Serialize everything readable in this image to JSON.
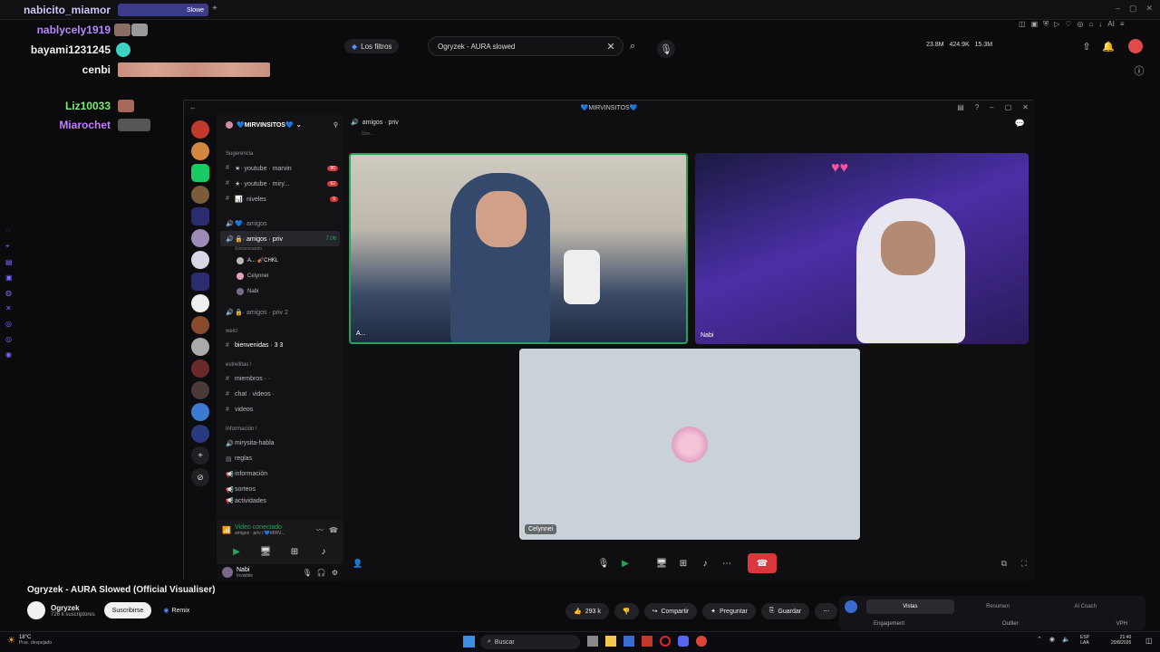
{
  "colors": {
    "accent_green": "#23a55a",
    "danger_red": "#da373c",
    "purple": "#b58cff",
    "yt_red": "#ff0000"
  },
  "browser": {
    "tab_title": "Slowe",
    "tab_new": "+"
  },
  "youtube_top": {
    "filters_label": "Los filtros",
    "search_value": "Ogryzek - AURA slowed",
    "stats": [
      "23.8M",
      "424.9K",
      "15.3M"
    ]
  },
  "chat_overlay": [
    {
      "name": "nabicito_miamor",
      "color": "#d3c6ff"
    },
    {
      "name": "nablycely1919",
      "color": "#b58cff"
    },
    {
      "name": "bayami1231245",
      "color": "#f1f1f1"
    },
    {
      "name": "cenbi",
      "color": "#f1f1f1"
    },
    {
      "name": "Liz10033",
      "color": "#7cf06b"
    },
    {
      "name": "Miarochet",
      "color": "#c77dff"
    }
  ],
  "discord": {
    "window_title": "💙MIRVINSITOS💙",
    "server_name": "💙MIRVINSITOS💙",
    "header_channel": "amigos · priv",
    "header_sub": "Stre...",
    "categories": [
      {
        "label": "Sugerencia",
        "channels": [
          {
            "label": "★· youtube · marvin",
            "badge": "80",
            "icon": "#"
          },
          {
            "label": "★· youtube · miry...",
            "badge": "62",
            "icon": "#"
          },
          {
            "label": "📊· niveles",
            "badge": "9",
            "icon": "#"
          }
        ]
      },
      {
        "label": "",
        "channels": [
          {
            "label": "💙· amigos",
            "badge": "",
            "icon": "🔊"
          },
          {
            "label": "🔒· amigos · priv",
            "badge": "7:06",
            "icon": "🔊",
            "active": true
          }
        ]
      }
    ],
    "voice_users": [
      "A... 🎻CHKL",
      "Celynnei",
      "Nabi"
    ],
    "streaming_label": "Streameando",
    "more_channels": [
      {
        "label": "🔒· amigos · priv 2",
        "icon": "🔊"
      }
    ],
    "category2": "welc!",
    "ch_bienvenidas": "bienvenidas · 3 3",
    "category3": "estrellitas !",
    "ch_miembros": "miembros · ·",
    "ch_chat": "chat · videos ·",
    "ch_videos": "videos",
    "category4": "Información !",
    "ch_info": [
      "mirysita-habla",
      "reglas",
      "información",
      "sorteos",
      "actividades"
    ],
    "voice_status": "Video conectado",
    "voice_status_sub": "amigos · priv / 💙MIRV...",
    "user_name": "Nabi",
    "user_status": "Invisible",
    "tile_labels": {
      "t1": "A...",
      "t2": "Nabi",
      "t3": "Celynnei"
    }
  },
  "video_info": {
    "title": "Ogryzek - AURA Slowed (Official Visualiser)",
    "channel": "Ogryzek",
    "subs": "726 k suscriptores",
    "subscribe_label": "Suscribirse",
    "remix_label": "Remix",
    "likes": "293 k",
    "share_label": "Compartir",
    "ask_label": "Preguntar",
    "save_label": "Guardar"
  },
  "side_panel": {
    "tab1": "Vistas",
    "tab2": "Resumen",
    "tab3": "AI Coach",
    "col1": "Engagement",
    "col2": "Outlier",
    "col3": "VPH"
  },
  "taskbar": {
    "weather_temp": "18°C",
    "weather_desc": "Prac. despejado",
    "search_label": "Buscar",
    "lang": "ESP",
    "lang2": "LAA",
    "time": "21:40",
    "date": "20/8/2026"
  }
}
